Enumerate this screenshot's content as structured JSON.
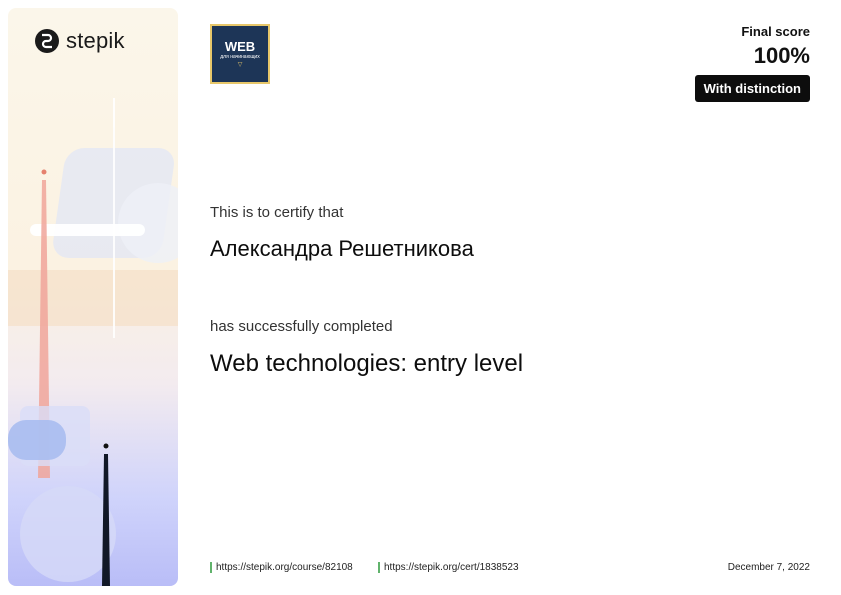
{
  "brand": {
    "logo_text": "stepik"
  },
  "course_logo": {
    "line1": "WEB",
    "line2": "для начинающих"
  },
  "score": {
    "label": "Final score",
    "value": "100%",
    "badge": "With distinction"
  },
  "certificate": {
    "intro": "This is to certify that",
    "recipient_name": "Александра Решетникова",
    "completed_text": "has successfully completed",
    "course_title": "Web technologies: entry level"
  },
  "footer": {
    "course_url": "https://stepik.org/course/82108",
    "cert_url": "https://stepik.org/cert/1838523",
    "date": "December 7, 2022"
  },
  "colors": {
    "link_marker": "#61b36c",
    "badge_bg": "#0d0d0d",
    "course_logo_bg": "#1d3557"
  }
}
